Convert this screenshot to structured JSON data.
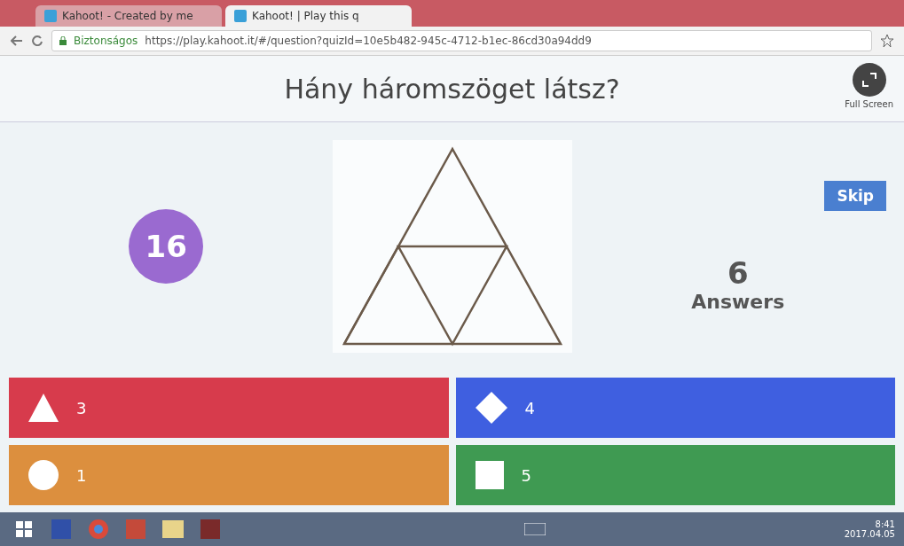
{
  "browser": {
    "tabs": [
      {
        "label": "Kahoot! - Created by me",
        "selected": false
      },
      {
        "label": "Kahoot! | Play this q",
        "selected": true
      }
    ],
    "security": "Biztonságos",
    "url": "https://play.kahoot.it/#/question?quizId=10e5b482-945c-4712-b1ec-86cd30a94dd9"
  },
  "question": {
    "title": "Hány háromszöget látsz?",
    "full_screen": "Full Screen",
    "timer": "16",
    "skip": "Skip",
    "answers_count": "6",
    "answers_label": "Answers"
  },
  "answers": [
    {
      "kind": "triangle",
      "label": "3",
      "color": "#d73b4c"
    },
    {
      "kind": "diamond",
      "label": "4",
      "color": "#3f5fe0"
    },
    {
      "kind": "circle",
      "label": "1",
      "color": "#dc8f3e"
    },
    {
      "kind": "square",
      "label": "5",
      "color": "#3f9a52"
    }
  ],
  "taskbar": {
    "time": "8:41",
    "date": "2017.04.05"
  }
}
